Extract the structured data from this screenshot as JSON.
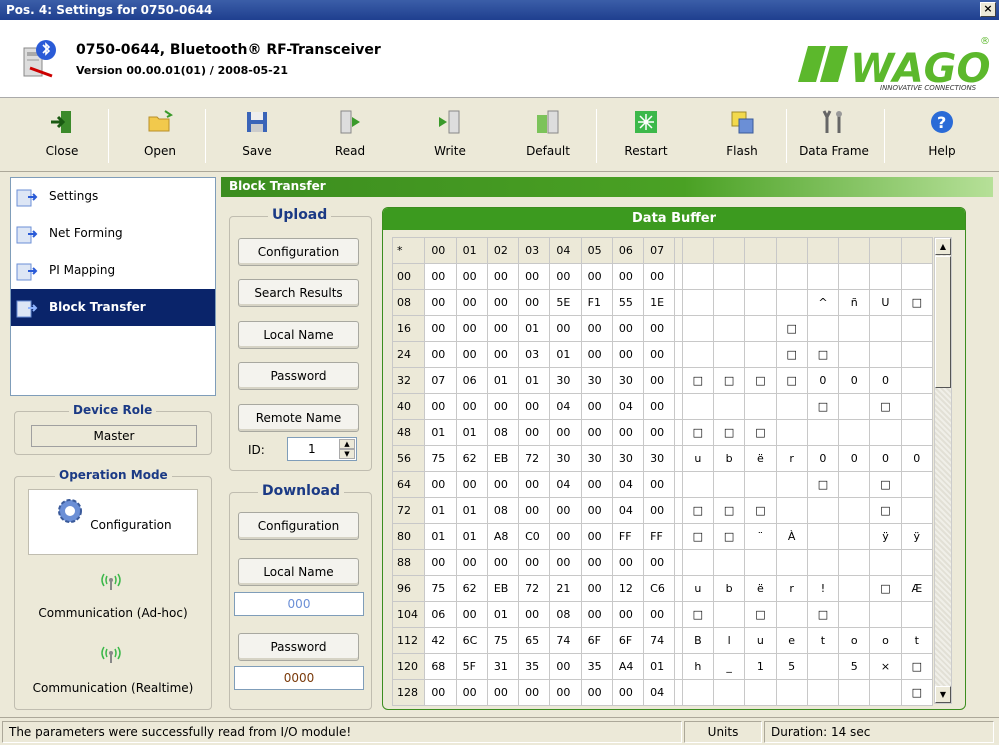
{
  "window": {
    "title": "Pos. 4: Settings for 0750-0644",
    "close_glyph": "×"
  },
  "header": {
    "device_name": "0750-0644, Bluetooth® RF-Transceiver",
    "version": "Version 00.00.01(01) / 2008-05-21",
    "logo_text": "WAGO",
    "logo_tagline": "INNOVATIVE CONNECTIONS",
    "logo_registered": "®"
  },
  "toolbar": {
    "close": "Close",
    "open": "Open",
    "save": "Save",
    "read": "Read",
    "write": "Write",
    "default": "Default",
    "restart": "Restart",
    "flash": "Flash",
    "data_frame": "Data Frame",
    "help": "Help"
  },
  "nav": {
    "items": [
      "Settings",
      "Net Forming",
      "PI Mapping",
      "Block Transfer"
    ],
    "active": "Block Transfer"
  },
  "device_role": {
    "label": "Device Role",
    "value": "Master"
  },
  "operation_mode": {
    "label": "Operation Mode",
    "configuration": "Configuration",
    "adhoc": "Communication (Ad-hoc)",
    "realtime": "Communication (Realtime)"
  },
  "section": {
    "title": "Block Transfer"
  },
  "upload": {
    "label": "Upload",
    "configuration": "Configuration",
    "search_results": "Search Results",
    "local_name": "Local Name",
    "password": "Password",
    "remote_name": "Remote Name",
    "id_label": "ID:",
    "id_value": "1"
  },
  "download": {
    "label": "Download",
    "configuration": "Configuration",
    "local_name": "Local Name",
    "local_name_value": "000",
    "password": "Password",
    "password_value": "0000"
  },
  "buffer": {
    "title": "Data Buffer",
    "columns": [
      "*",
      "00",
      "01",
      "02",
      "03",
      "04",
      "05",
      "06",
      "07"
    ],
    "rows": [
      {
        "addr": "00",
        "hex": [
          "00",
          "00",
          "00",
          "00",
          "00",
          "00",
          "00",
          "00"
        ],
        "ascii": [
          "",
          "",
          "",
          "",
          "",
          "",
          "",
          ""
        ]
      },
      {
        "addr": "08",
        "hex": [
          "00",
          "00",
          "00",
          "00",
          "5E",
          "F1",
          "55",
          "1E"
        ],
        "ascii": [
          "",
          "",
          "",
          "",
          "^",
          "ñ",
          "U",
          "□"
        ]
      },
      {
        "addr": "16",
        "hex": [
          "00",
          "00",
          "00",
          "01",
          "00",
          "00",
          "00",
          "00"
        ],
        "ascii": [
          "",
          "",
          "",
          "□",
          "",
          "",
          "",
          ""
        ]
      },
      {
        "addr": "24",
        "hex": [
          "00",
          "00",
          "00",
          "03",
          "01",
          "00",
          "00",
          "00"
        ],
        "ascii": [
          "",
          "",
          "",
          "□",
          "□",
          "",
          "",
          ""
        ]
      },
      {
        "addr": "32",
        "hex": [
          "07",
          "06",
          "01",
          "01",
          "30",
          "30",
          "30",
          "00"
        ],
        "ascii": [
          "□",
          "□",
          "□",
          "□",
          "0",
          "0",
          "0",
          ""
        ]
      },
      {
        "addr": "40",
        "hex": [
          "00",
          "00",
          "00",
          "00",
          "04",
          "00",
          "04",
          "00"
        ],
        "ascii": [
          "",
          "",
          "",
          "",
          "□",
          "",
          "□",
          ""
        ]
      },
      {
        "addr": "48",
        "hex": [
          "01",
          "01",
          "08",
          "00",
          "00",
          "00",
          "00",
          "00"
        ],
        "ascii": [
          "□",
          "□",
          "□",
          "",
          "",
          "",
          "",
          ""
        ]
      },
      {
        "addr": "56",
        "hex": [
          "75",
          "62",
          "EB",
          "72",
          "30",
          "30",
          "30",
          "30"
        ],
        "ascii": [
          "u",
          "b",
          "ë",
          "r",
          "0",
          "0",
          "0",
          "0"
        ]
      },
      {
        "addr": "64",
        "hex": [
          "00",
          "00",
          "00",
          "00",
          "04",
          "00",
          "04",
          "00"
        ],
        "ascii": [
          "",
          "",
          "",
          "",
          "□",
          "",
          "□",
          ""
        ]
      },
      {
        "addr": "72",
        "hex": [
          "01",
          "01",
          "08",
          "00",
          "00",
          "00",
          "04",
          "00"
        ],
        "ascii": [
          "□",
          "□",
          "□",
          "",
          "",
          "",
          "□",
          ""
        ]
      },
      {
        "addr": "80",
        "hex": [
          "01",
          "01",
          "A8",
          "C0",
          "00",
          "00",
          "FF",
          "FF"
        ],
        "ascii": [
          "□",
          "□",
          "¨",
          "À",
          "",
          "",
          "ÿ",
          "ÿ"
        ]
      },
      {
        "addr": "88",
        "hex": [
          "00",
          "00",
          "00",
          "00",
          "00",
          "00",
          "00",
          "00"
        ],
        "ascii": [
          "",
          "",
          "",
          "",
          "",
          "",
          "",
          ""
        ]
      },
      {
        "addr": "96",
        "hex": [
          "75",
          "62",
          "EB",
          "72",
          "21",
          "00",
          "12",
          "C6"
        ],
        "ascii": [
          "u",
          "b",
          "ë",
          "r",
          "!",
          "",
          "□",
          "Æ"
        ]
      },
      {
        "addr": "104",
        "hex": [
          "06",
          "00",
          "01",
          "00",
          "08",
          "00",
          "00",
          "00"
        ],
        "ascii": [
          "□",
          "",
          "□",
          "",
          "□",
          "",
          "",
          ""
        ]
      },
      {
        "addr": "112",
        "hex": [
          "42",
          "6C",
          "75",
          "65",
          "74",
          "6F",
          "6F",
          "74"
        ],
        "ascii": [
          "B",
          "l",
          "u",
          "e",
          "t",
          "o",
          "o",
          "t"
        ]
      },
      {
        "addr": "120",
        "hex": [
          "68",
          "5F",
          "31",
          "35",
          "00",
          "35",
          "A4",
          "01"
        ],
        "ascii": [
          "h",
          "_",
          "1",
          "5",
          "",
          "5",
          "×",
          "□"
        ]
      },
      {
        "addr": "128",
        "hex": [
          "00",
          "00",
          "00",
          "00",
          "00",
          "00",
          "00",
          "04"
        ],
        "ascii": [
          "",
          "",
          "",
          "",
          "",
          "",
          "",
          "□"
        ]
      }
    ]
  },
  "scroll": {
    "up": "▲",
    "down": "▼"
  },
  "status": {
    "message": "The parameters were successfully read from I/O module!",
    "units": "Units",
    "duration": "Duration: 14 sec"
  },
  "colors": {
    "accent_green": "#3c9a1f",
    "title_blue": "#1b3a85",
    "active_nav": "#0a246a"
  }
}
